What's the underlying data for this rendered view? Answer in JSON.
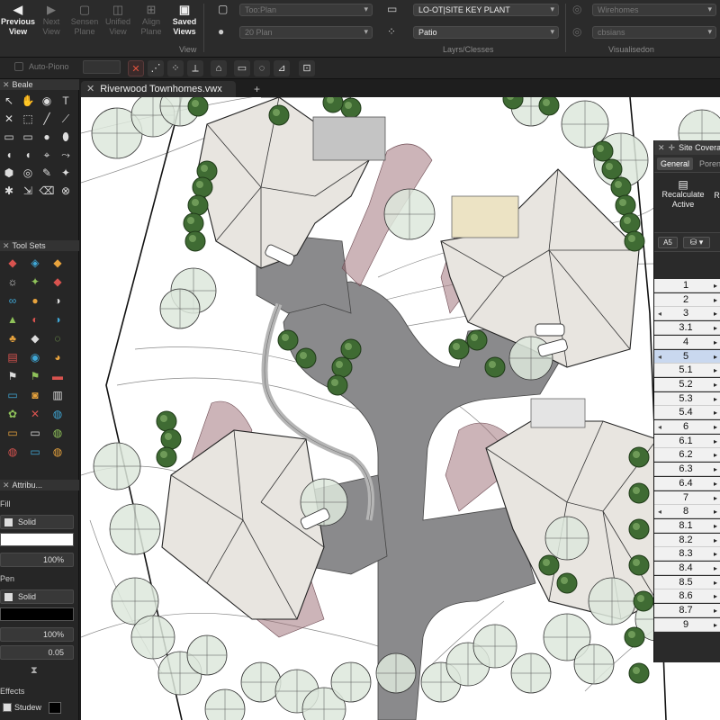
{
  "toolbar": {
    "view_buttons": [
      {
        "label": "Previous View",
        "icon": "back-arrow-icon",
        "active": true
      },
      {
        "label": "Next View",
        "icon": "forward-arrow-icon",
        "active": false
      },
      {
        "label": "Sensen Plane",
        "icon": "screen-plane-icon",
        "active": false
      },
      {
        "label": "Unified View",
        "icon": "unified-view-icon",
        "active": false
      },
      {
        "label": "Align Plane",
        "icon": "align-plane-icon",
        "active": false
      },
      {
        "label": "Saved Views",
        "icon": "saved-views-icon",
        "active": true
      }
    ],
    "view_group_label": "View",
    "left_dropdowns": [
      {
        "value": "Too:Plan"
      },
      {
        "value": "20 Plan"
      }
    ],
    "layer_dropdowns": [
      {
        "value": "LO-OT|SITE KEY PLANT"
      },
      {
        "value": "Patio"
      }
    ],
    "layers_group_label": "Layrs/Clesses",
    "vis_dropdowns": [
      {
        "value": "Wirehomes"
      },
      {
        "value": "cbsians"
      }
    ],
    "vis_group_label": "Visualisedon",
    "autopiono_label": "Auto-Piono"
  },
  "palettes": {
    "basic_title": "Beale",
    "toolsets_title": "Tool Sets",
    "attributes_title": "Attribu...",
    "fill_label": "Fill",
    "fill_style": "Solid",
    "fill_opacity": "100%",
    "pen_label": "Pen",
    "pen_style": "Solid",
    "pen_opacity": "100%",
    "line_weight": "0.05",
    "effects_label": "Effects",
    "shadow_label": "Studew",
    "colors": {
      "fill": "#ffffff",
      "pen": "#000000"
    }
  },
  "document": {
    "tab_title": "Riverwood Townhomes.vwx",
    "add_tab_glyph": "+"
  },
  "site_panel": {
    "title": "Site Covera",
    "tabs": [
      "General",
      "Porent"
    ],
    "actions": [
      "Recalculate Active",
      "Re"
    ],
    "sheet_dropdown": "A5",
    "rows": [
      {
        "label": "1",
        "selected": false,
        "left_chevron": false
      },
      {
        "label": "2",
        "selected": false,
        "left_chevron": false
      },
      {
        "label": "3",
        "selected": false,
        "left_chevron": true
      },
      {
        "label": "3.1",
        "selected": false,
        "left_chevron": false
      },
      {
        "label": "4",
        "selected": false,
        "left_chevron": false
      },
      {
        "label": "5",
        "selected": true,
        "left_chevron": true
      },
      {
        "label": "5.1",
        "selected": false,
        "left_chevron": false
      },
      {
        "label": "5.2",
        "selected": false,
        "left_chevron": false
      },
      {
        "label": "5.3",
        "selected": false,
        "left_chevron": false
      },
      {
        "label": "5.4",
        "selected": false,
        "left_chevron": false
      },
      {
        "label": "6",
        "selected": false,
        "left_chevron": true
      },
      {
        "label": "6.1",
        "selected": false,
        "left_chevron": false
      },
      {
        "label": "6.2",
        "selected": false,
        "left_chevron": false
      },
      {
        "label": "6.3",
        "selected": false,
        "left_chevron": false
      },
      {
        "label": "6.4",
        "selected": false,
        "left_chevron": false
      },
      {
        "label": "7",
        "selected": false,
        "left_chevron": false
      },
      {
        "label": "8",
        "selected": false,
        "left_chevron": true
      },
      {
        "label": "8.1",
        "selected": false,
        "left_chevron": false
      },
      {
        "label": "8.2",
        "selected": false,
        "left_chevron": false
      },
      {
        "label": "8.3",
        "selected": false,
        "left_chevron": false
      },
      {
        "label": "8.4",
        "selected": false,
        "left_chevron": false
      },
      {
        "label": "8.5",
        "selected": false,
        "left_chevron": false
      },
      {
        "label": "8.6",
        "selected": false,
        "left_chevron": false
      },
      {
        "label": "8.7",
        "selected": false,
        "left_chevron": false
      },
      {
        "label": "9",
        "selected": false,
        "left_chevron": false
      }
    ]
  },
  "plan": {
    "road_color": "#8a8a8c",
    "roof_color": "#e8e5e0",
    "tree_dark_color": "#3f6b33",
    "tree_light_color": "#dde8dc",
    "bed_color": "#9a6a72"
  }
}
